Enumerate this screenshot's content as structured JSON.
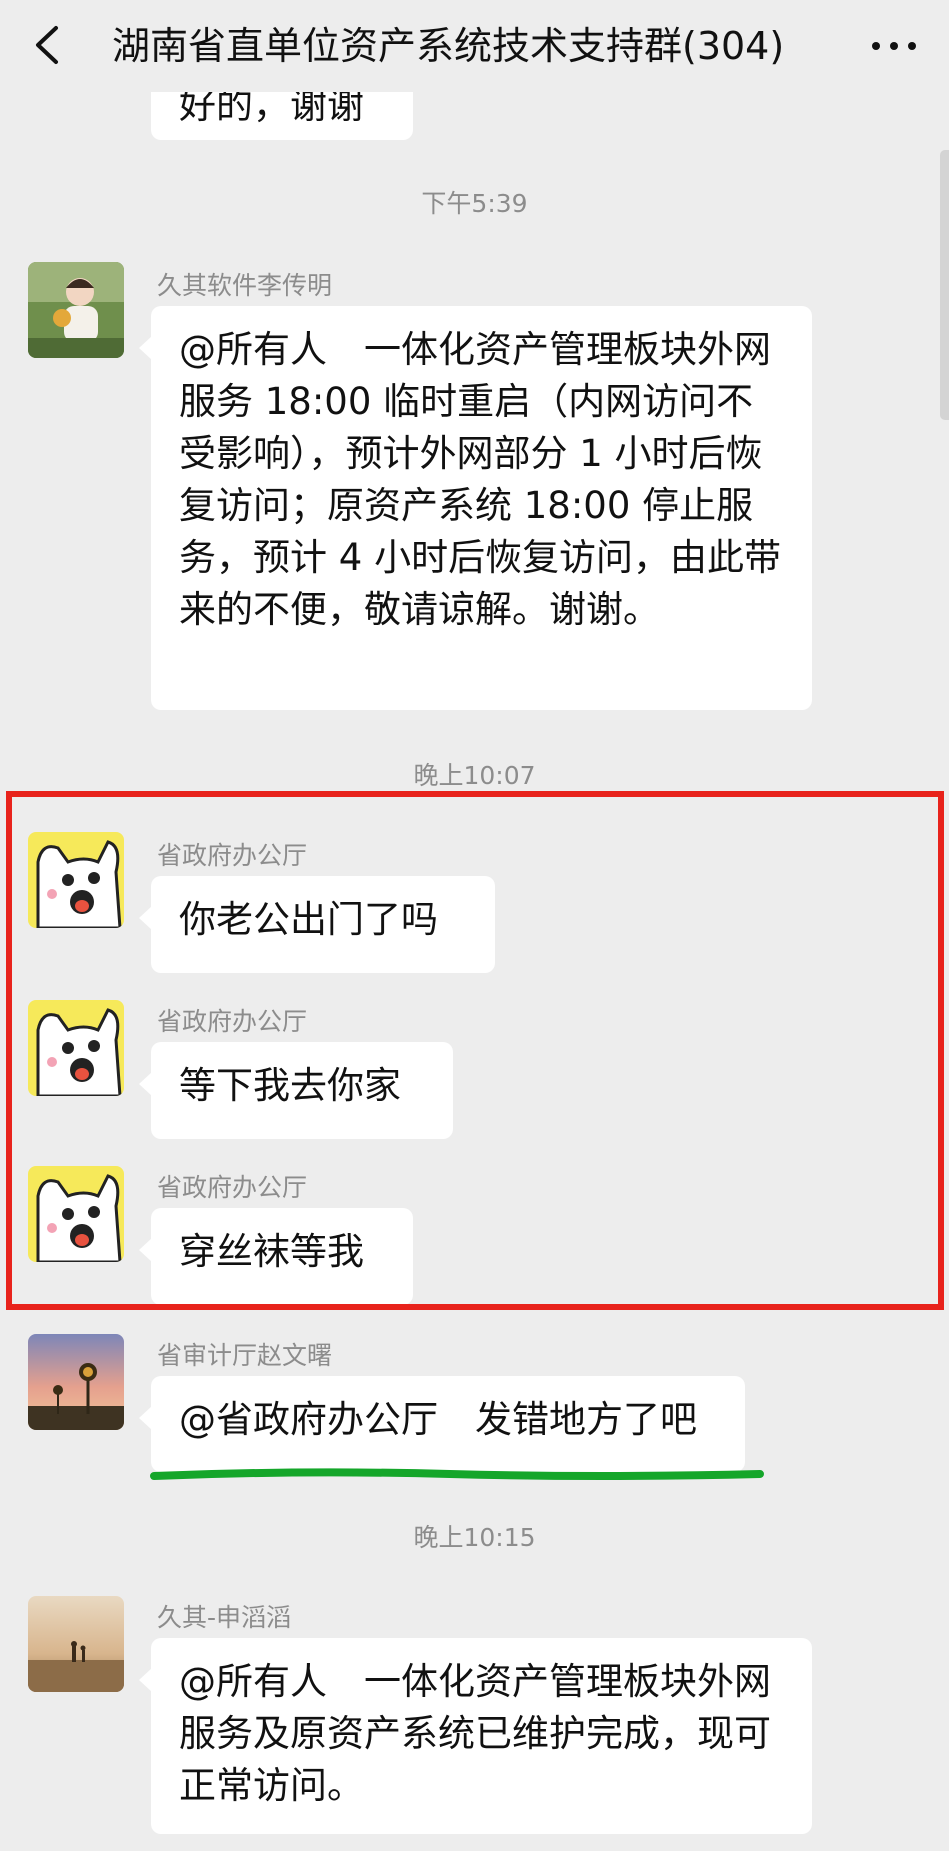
{
  "header": {
    "title": "湖南省直单位资产系统技术支持群(304)",
    "back_icon": "chevron-left-icon",
    "more_icon": "more-dots-icon"
  },
  "colors": {
    "background": "#ededed",
    "bubble": "#ffffff",
    "highlight_red": "#e8231c",
    "underline_green": "#15a62a"
  },
  "messages": {
    "partial_top": {
      "text": "好的，谢谢"
    },
    "timestamp_1": "下午5:39",
    "msg_1": {
      "sender": "久其软件李传明",
      "text": "@所有人　一体化资产管理板块外网服务 18:00 临时重启（内网访问不受影响），预计外网部分 1 小时后恢复访问；原资产系统 18:00 停止服务，预计 4 小时后恢复访问，由此带来的不便，敬请谅解。谢谢。"
    },
    "timestamp_2": "晚上10:07",
    "msg_2": {
      "sender": "省政府办公厅",
      "text": "你老公出门了吗"
    },
    "msg_3": {
      "sender": "省政府办公厅",
      "text": "等下我去你家"
    },
    "msg_4": {
      "sender": "省政府办公厅",
      "text": "穿丝袜等我"
    },
    "msg_5": {
      "sender": "省审计厅赵文曙",
      "text": "@省政府办公厅　发错地方了吧"
    },
    "timestamp_3": "晚上10:15",
    "msg_6": {
      "sender": "久其-申滔滔",
      "text": "@所有人　一体化资产管理板块外网服务及原资产系统已维护完成，现可正常访问。"
    }
  }
}
